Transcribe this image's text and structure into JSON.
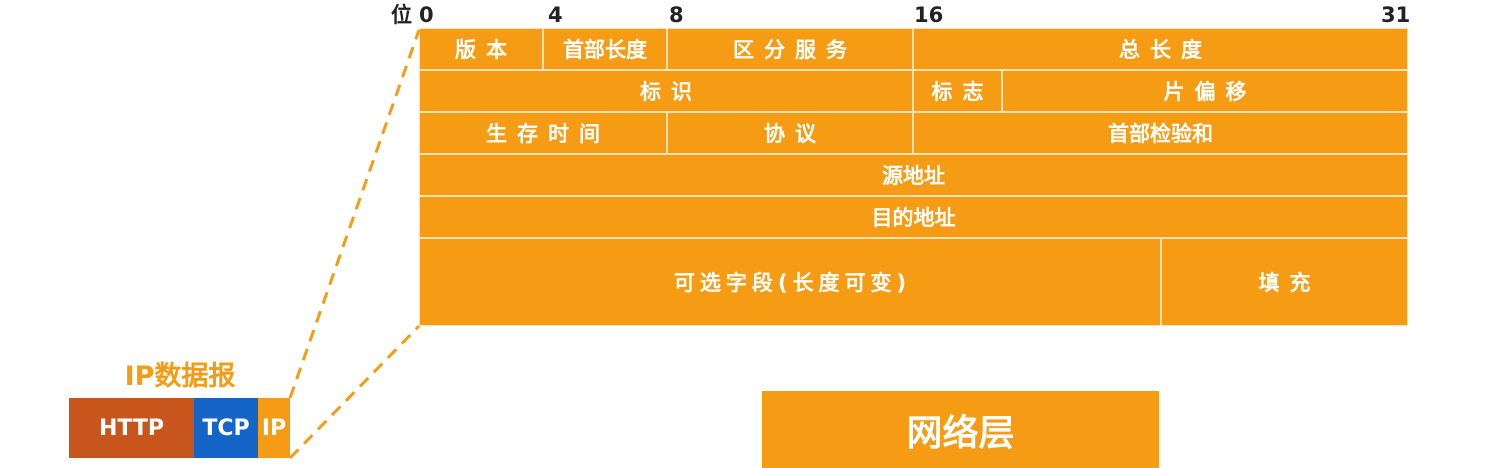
{
  "bit_axis": {
    "prefix": "位",
    "b0": "0",
    "b4": "4",
    "b8": "8",
    "b16": "16",
    "b31": "31"
  },
  "header": {
    "row1": {
      "version": "版本",
      "header_length": "首部长度",
      "diff_services": "区分服务",
      "total_length": "总长度"
    },
    "row2": {
      "identification": "标识",
      "flags": "标志",
      "fragment_offset": "片偏移"
    },
    "row3": {
      "ttl": "生存时间",
      "protocol": "协议",
      "header_checksum": "首部检验和"
    },
    "row4": {
      "source_address": "源地址"
    },
    "row5": {
      "dest_address": "目的地址"
    },
    "row6": {
      "options": "可选字段(长度可变)",
      "padding": "填充"
    }
  },
  "datagram": {
    "title": "IP数据报",
    "segments": {
      "http": "HTTP",
      "tcp": "TCP",
      "ip": "IP"
    }
  },
  "layer_label": "网络层",
  "colors": {
    "orange": "#f59b14",
    "rust": "#c8561c",
    "blue": "#1565c8",
    "cell_border": "#fde2b5"
  }
}
